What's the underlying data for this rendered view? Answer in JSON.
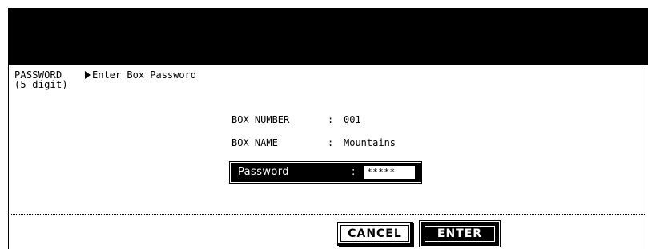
{
  "header": {
    "mode_label_line1": "PASSWORD",
    "mode_label_line2": "(5-digit)",
    "instruction": "Enter Box Password"
  },
  "box_info": {
    "number_label": "BOX NUMBER",
    "number_value": "001",
    "name_label": "BOX NAME",
    "name_value": "Mountains",
    "separator": ":"
  },
  "password_field": {
    "label": "Password",
    "separator": ":",
    "value": "*****"
  },
  "buttons": {
    "cancel_label": "CANCEL",
    "enter_label": "ENTER"
  },
  "icons": {
    "instruction_marker": "play-arrow-icon"
  },
  "colors": {
    "background": "#ffffff",
    "header_bar": "#000000",
    "text": "#000000",
    "highlight": "#000000"
  }
}
